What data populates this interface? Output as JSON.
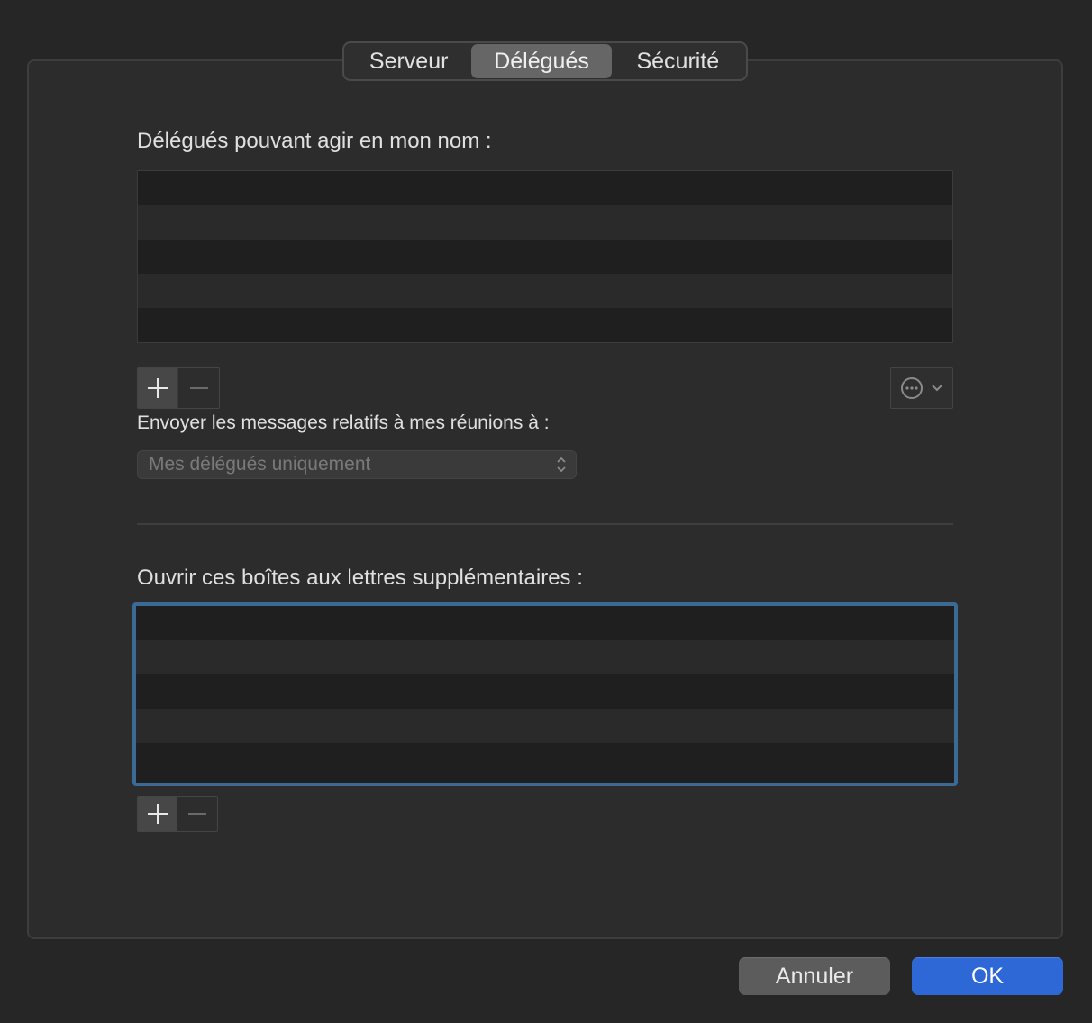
{
  "tabs": [
    {
      "label": "Serveur",
      "selected": false
    },
    {
      "label": "Délégués",
      "selected": true
    },
    {
      "label": "Sécurité",
      "selected": false
    }
  ],
  "delegates": {
    "title": "Délégués pouvant agir en mon nom :",
    "rows": [],
    "add_icon": "plus-icon",
    "remove_icon": "minus-icon",
    "action_icon": "ellipsis-circle-icon"
  },
  "meeting_messages": {
    "label": "Envoyer les messages relatifs à mes réunions à :",
    "selected_value": "Mes délégués uniquement"
  },
  "mailboxes": {
    "title": "Ouvrir ces boîtes aux lettres supplémentaires :",
    "rows": []
  },
  "buttons": {
    "cancel": "Annuler",
    "ok": "OK"
  },
  "colors": {
    "accent": "#2e67d6",
    "focus_ring": "#3c6a96"
  }
}
